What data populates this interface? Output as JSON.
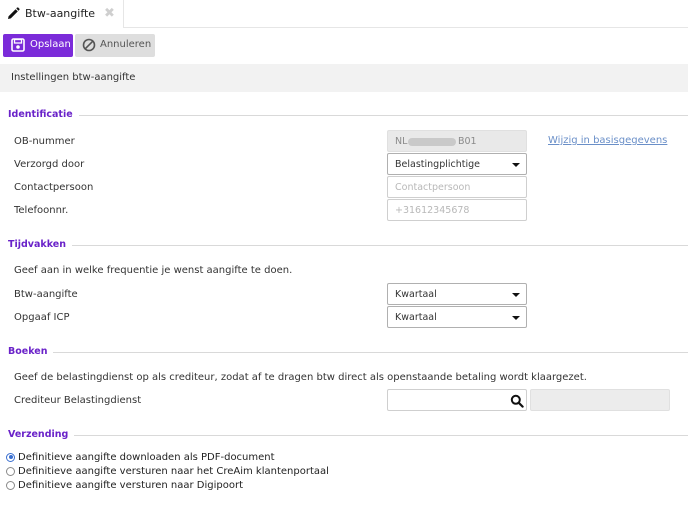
{
  "tab": {
    "label": "Btw-aangifte",
    "close_glyph": "✖"
  },
  "toolbar": {
    "save_label": "Opslaan",
    "cancel_label": "Annuleren"
  },
  "settings_header": "Instellingen btw-aangifte",
  "identificatie": {
    "title": "Identificatie",
    "ob_label": "OB-nummer",
    "ob_prefix": "NL",
    "ob_suffix": "B01",
    "change_link": "Wijzig in basisgegevens",
    "verzorgd_label": "Verzorgd door",
    "verzorgd_value": "Belastingplichtige",
    "contact_label": "Contactpersoon",
    "contact_placeholder": "Contactpersoon",
    "telefoon_label": "Telefoonnr.",
    "telefoon_placeholder": "+31612345678"
  },
  "tijdvakken": {
    "title": "Tijdvakken",
    "intro": "Geef aan in welke frequentie je wenst aangifte te doen.",
    "btw_label": "Btw-aangifte",
    "btw_value": "Kwartaal",
    "icp_label": "Opgaaf ICP",
    "icp_value": "Kwartaal"
  },
  "boeken": {
    "title": "Boeken",
    "intro": "Geef de belastingdienst op als crediteur, zodat af te dragen btw direct als openstaande betaling wordt klaargezet.",
    "crediteur_label": "Crediteur Belastingdienst"
  },
  "verzending": {
    "title": "Verzending",
    "options": [
      {
        "label": "Definitieve aangifte downloaden als PDF-document",
        "checked": true
      },
      {
        "label": "Definitieve aangifte versturen naar het CreAim klantenportaal",
        "checked": false
      },
      {
        "label": "Definitieve aangifte versturen naar Digipoort",
        "checked": false
      }
    ]
  },
  "colors": {
    "accent": "#7b2bd9",
    "section_title": "#6a22c9",
    "link": "#6a8fc8"
  },
  "icons": [
    "pencil-icon",
    "close-icon",
    "save-icon",
    "cancel-icon",
    "chevron-down-icon",
    "search-icon"
  ]
}
